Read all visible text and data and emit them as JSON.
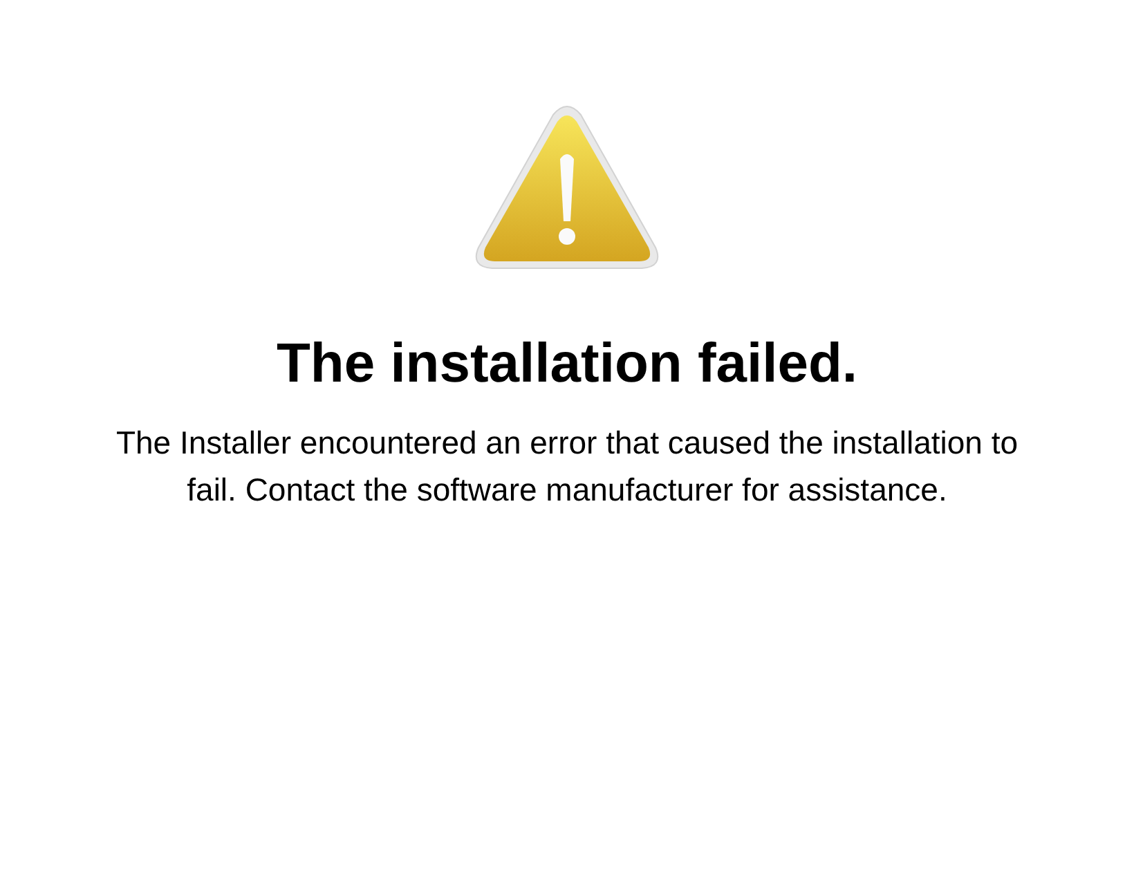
{
  "title": "The installation failed.",
  "message": "The Installer encountered an error that caused the installation to fail. Contact the software manufacturer for assistance."
}
